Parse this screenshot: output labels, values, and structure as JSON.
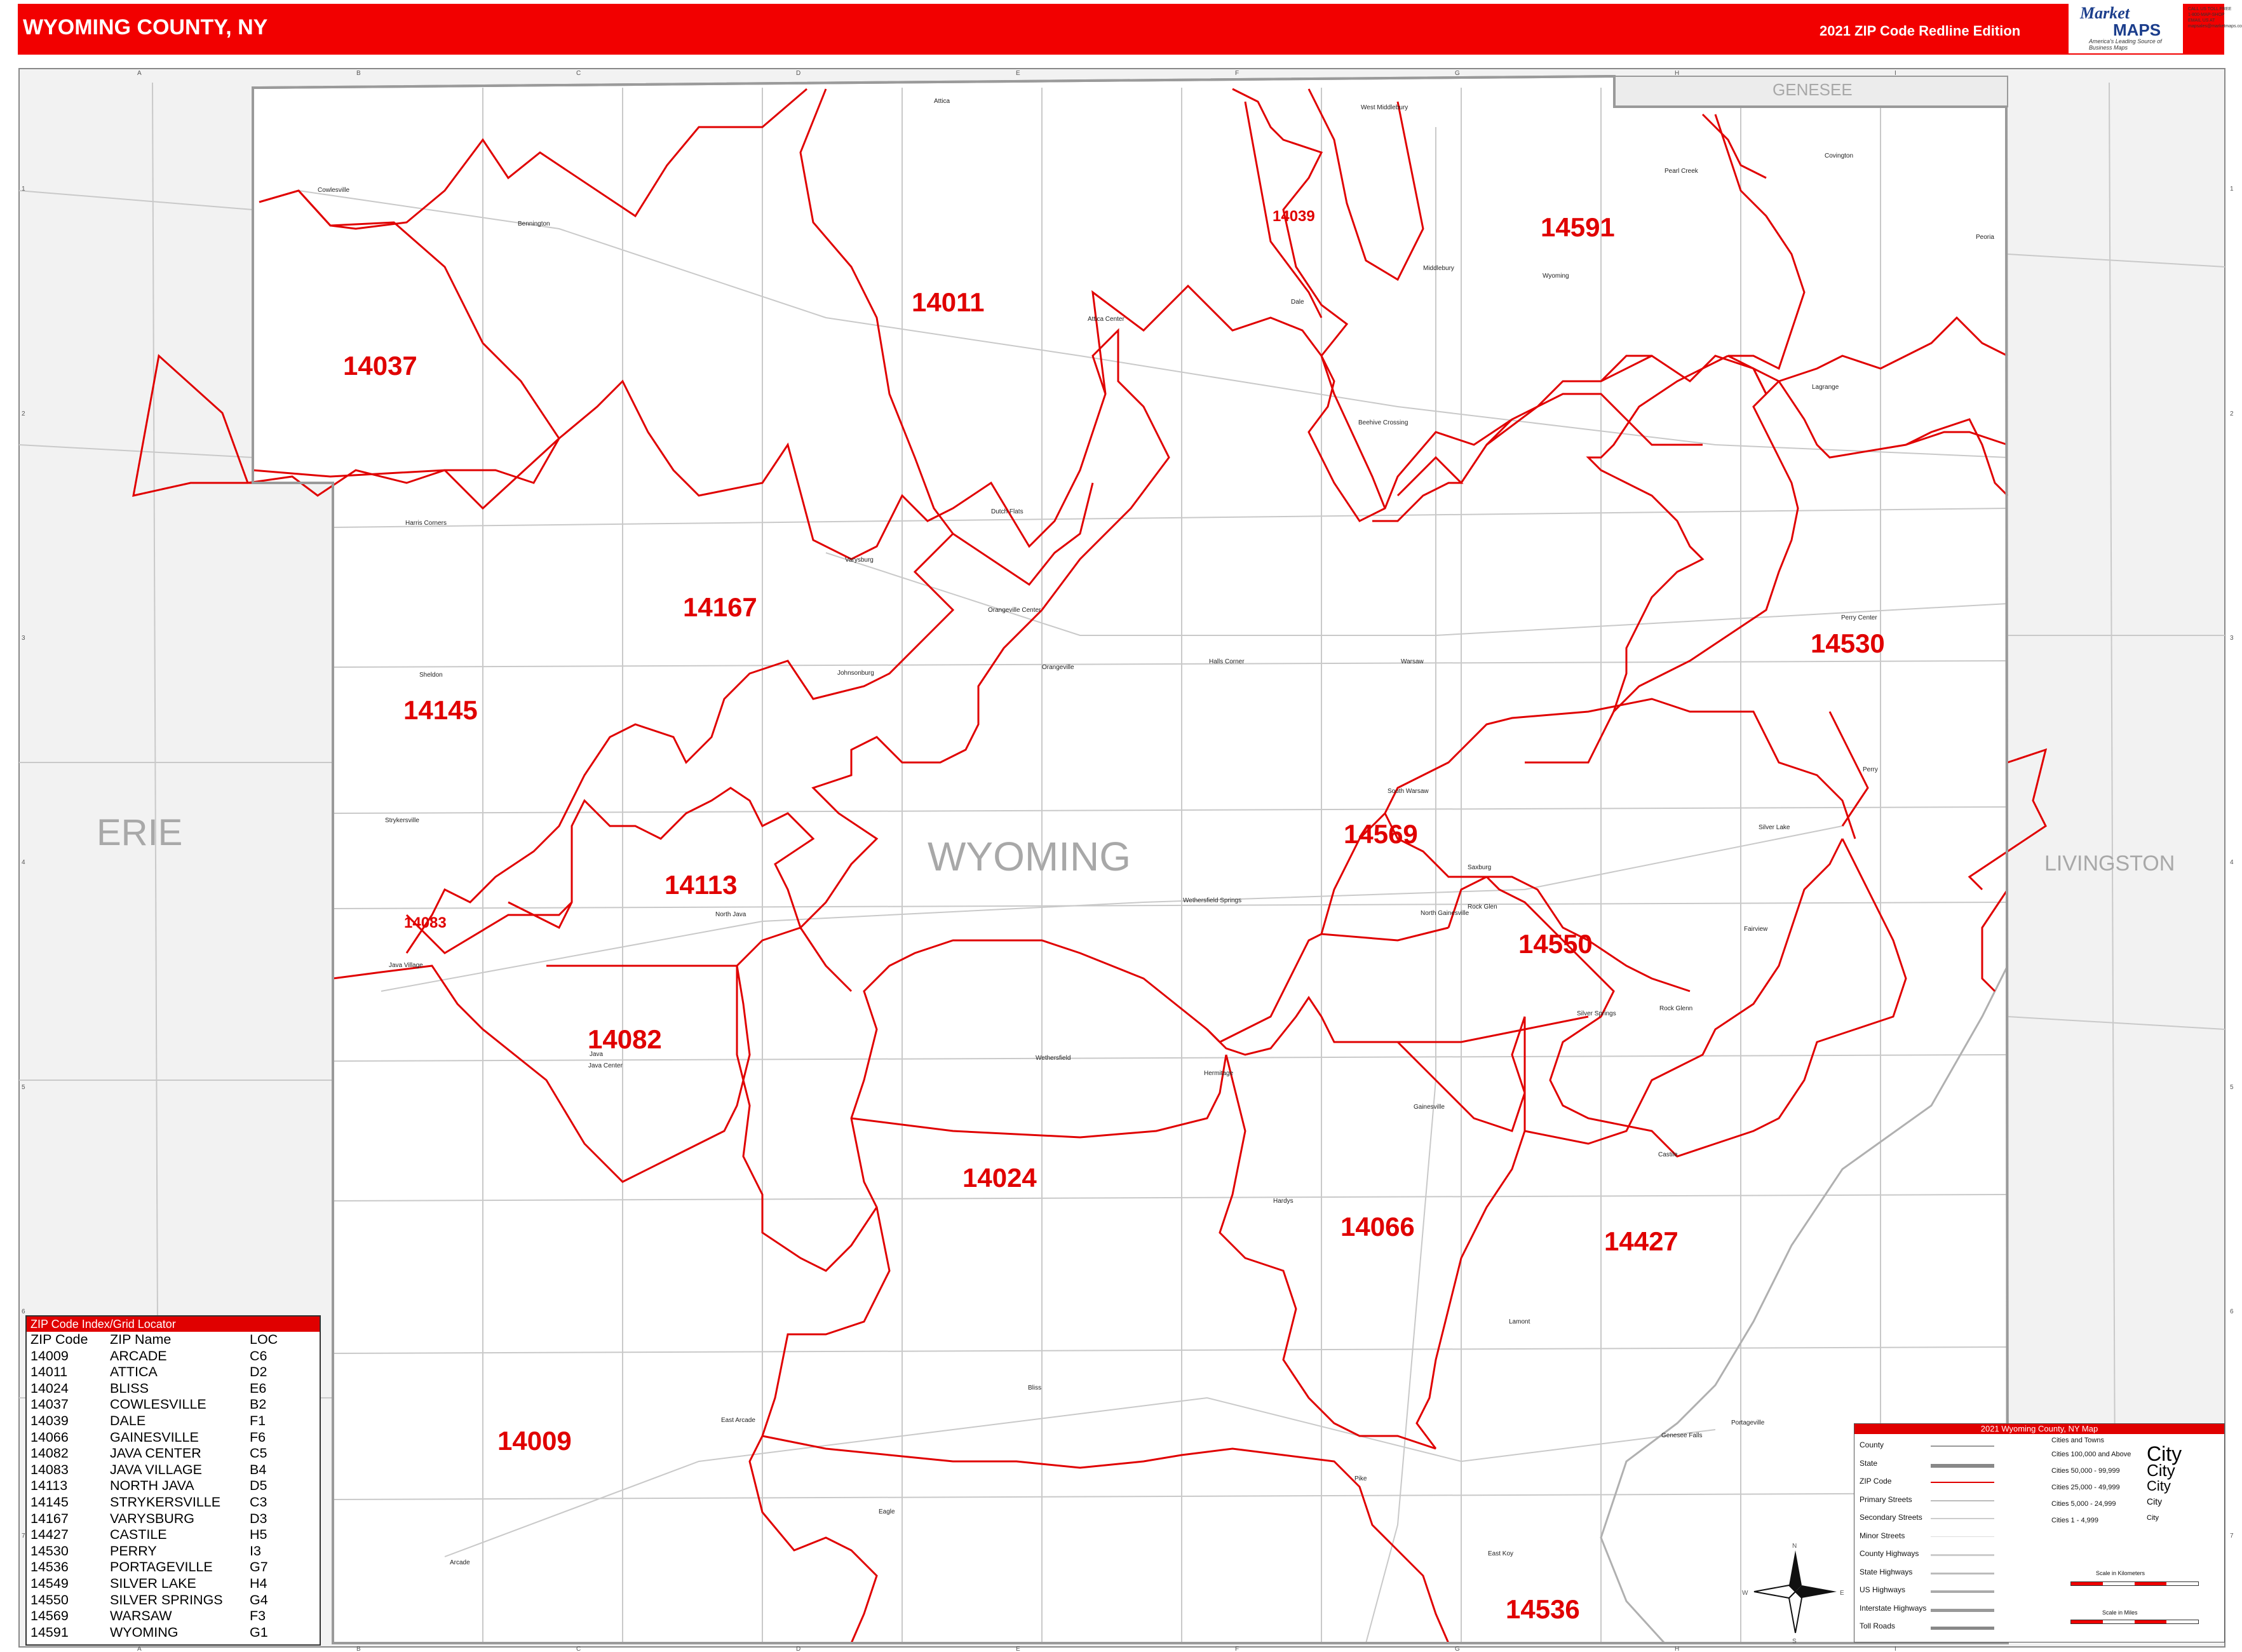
{
  "header": {
    "title": "WYOMING COUNTY, NY",
    "edition": "2021 ZIP Code Redline Edition",
    "logo_word1": "Market",
    "logo_word2": "MAPS",
    "logo_tagline": "America's Leading Source of Business Maps",
    "logo_side": [
      "CALL US TOLL FREE",
      "1-800-MAP-SHOP",
      "EMAIL US AT",
      "mapsales@marketmaps.com"
    ]
  },
  "map": {
    "county_label": "WYOMING",
    "neighbors": [
      "ERIE",
      "GENESEE",
      "LIVINGSTON"
    ],
    "zip_labels": [
      "14037",
      "14011",
      "14039",
      "14591",
      "14167",
      "14145",
      "14530",
      "14569",
      "14113",
      "14083",
      "14550",
      "14082",
      "14024",
      "14066",
      "14427",
      "14009",
      "14536"
    ],
    "places": [
      "Cowlesville",
      "Bennington",
      "Attica",
      "Attica Center",
      "Dale",
      "West Middlebury",
      "Middlebury",
      "Wyoming",
      "Pearl Creek",
      "Covington",
      "Peoria",
      "Lagrange",
      "Beehive Crossing",
      "Harris Corners",
      "Dutch Flats",
      "Varysburg",
      "Orangeville Center",
      "Orangeville",
      "Johnsonburg",
      "Halls Corner",
      "Warsaw",
      "Perry Center",
      "Perry",
      "Sheldon",
      "Strykersville",
      "South Warsaw",
      "Silver Lake",
      "Rock Glen",
      "Wethersfield Springs",
      "North Gainesville",
      "Saxburg",
      "North Java",
      "Java Village",
      "Fairview",
      "Silver Springs",
      "Rock Glenn",
      "Java",
      "Java Center",
      "Wethersfield",
      "Hermitage",
      "Gainesville",
      "Castile",
      "Hardys",
      "Lamont",
      "East Arcade",
      "Bliss",
      "Genesee Falls",
      "Portageville",
      "Arcade",
      "Eagle",
      "Pike",
      "East Koy"
    ],
    "grid_cols": [
      "A",
      "B",
      "C",
      "D",
      "E",
      "F",
      "G",
      "H",
      "I"
    ],
    "grid_rows": [
      "1",
      "2",
      "3",
      "4",
      "5",
      "6",
      "7"
    ],
    "compass": [
      "N",
      "E",
      "S",
      "W"
    ]
  },
  "index": {
    "title": "ZIP Code Index/Grid Locator",
    "headers": [
      "ZIP Code",
      "ZIP Name",
      "LOC"
    ],
    "rows": [
      [
        "14009",
        "ARCADE",
        "C6"
      ],
      [
        "14011",
        "ATTICA",
        "D2"
      ],
      [
        "14024",
        "BLISS",
        "E6"
      ],
      [
        "14037",
        "COWLESVILLE",
        "B2"
      ],
      [
        "14039",
        "DALE",
        "F1"
      ],
      [
        "14066",
        "GAINESVILLE",
        "F6"
      ],
      [
        "14082",
        "JAVA CENTER",
        "C5"
      ],
      [
        "14083",
        "JAVA VILLAGE",
        "B4"
      ],
      [
        "14113",
        "NORTH JAVA",
        "D5"
      ],
      [
        "14145",
        "STRYKERSVILLE",
        "C3"
      ],
      [
        "14167",
        "VARYSBURG",
        "D3"
      ],
      [
        "14427",
        "CASTILE",
        "H5"
      ],
      [
        "14530",
        "PERRY",
        "I3"
      ],
      [
        "14536",
        "PORTAGEVILLE",
        "G7"
      ],
      [
        "14549",
        "SILVER LAKE",
        "H4"
      ],
      [
        "14550",
        "SILVER SPRINGS",
        "G4"
      ],
      [
        "14569",
        "WARSAW",
        "F3"
      ],
      [
        "14591",
        "WYOMING",
        "G1"
      ]
    ]
  },
  "legend": {
    "title": "2021 Wyoming County, NY Map",
    "items": [
      "County",
      "State",
      "ZIP Code",
      "Primary Streets",
      "Secondary Streets",
      "Minor Streets",
      "County Highways",
      "State Highways",
      "US Highways",
      "Interstate Highways",
      "Toll Roads"
    ],
    "cities_header": "Cities and Towns",
    "cities": [
      "Cities 100,000 and Above",
      "Cities 50,000 - 99,999",
      "Cities 25,000 - 49,999",
      "Cities 5,000 - 24,999",
      "Cities 1 - 4,999"
    ],
    "city_word": "City",
    "scale_km": "Scale in Kilometers",
    "scale_mi": "Scale in Miles",
    "colors": {
      "zip_line": "#e00000",
      "county_line": "#999999",
      "header": "#f20000"
    }
  }
}
